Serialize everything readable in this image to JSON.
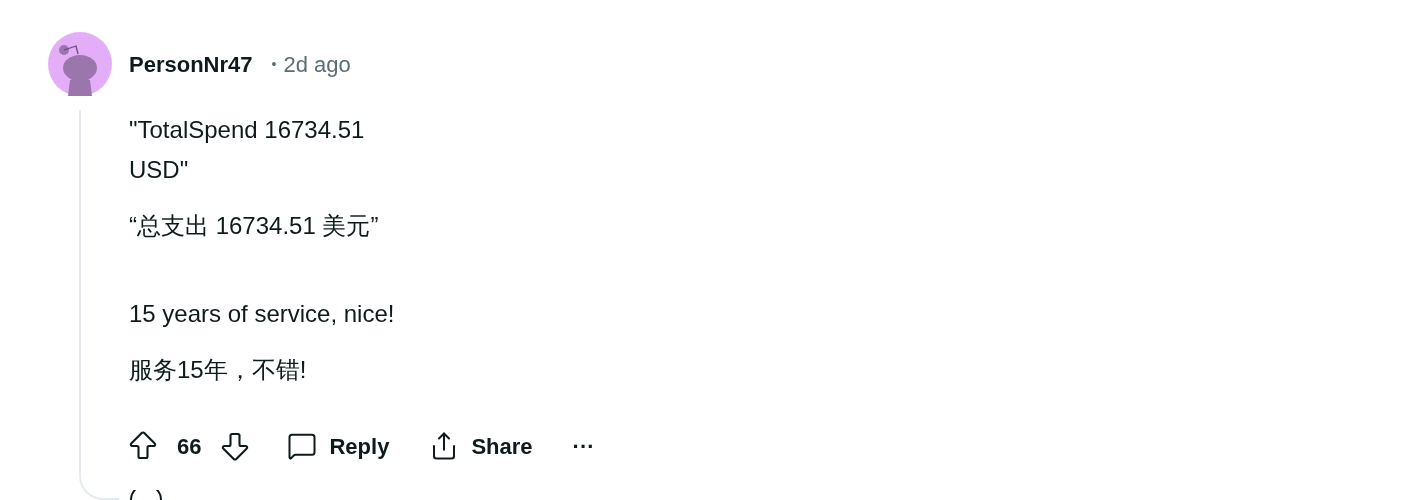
{
  "comment": {
    "author": "PersonNr47",
    "separator": "•",
    "time": "2d ago",
    "body_blocks": [
      [
        "\"TotalSpend 16734.51\nUSD\"",
        "“总支出 16734.51 美元”"
      ],
      [
        "15 years of service, nice!",
        "服务15年，不错!"
      ]
    ],
    "score": "66",
    "actions": [
      {
        "kind": "reply",
        "label": "Reply"
      },
      {
        "kind": "share",
        "label": "Share"
      },
      {
        "kind": "more",
        "label": "···"
      }
    ]
  }
}
